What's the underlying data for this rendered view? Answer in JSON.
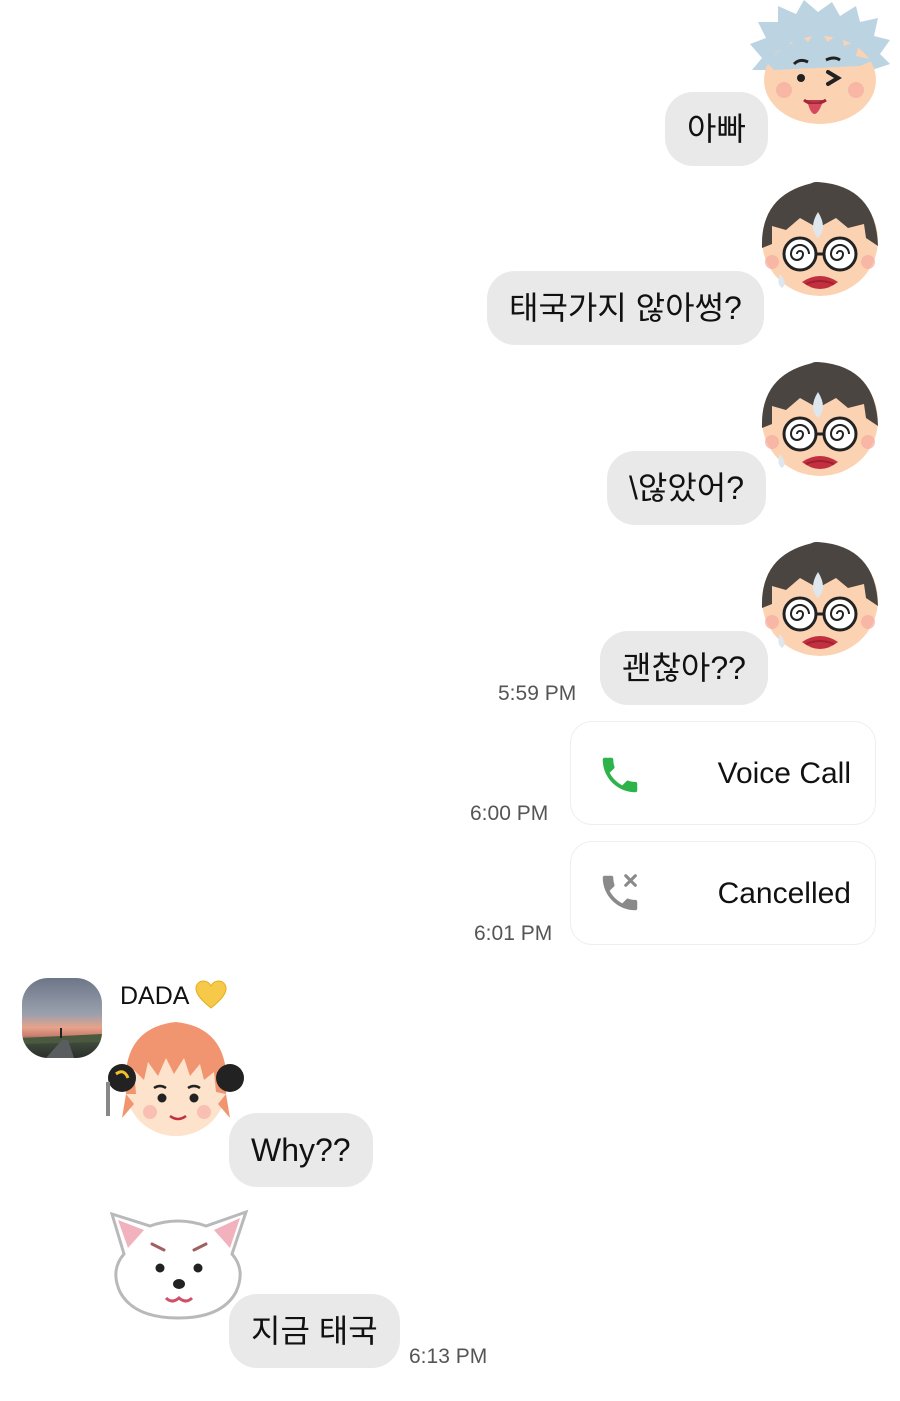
{
  "messages_sent": [
    {
      "text": "아빠",
      "sticker": "silver-hair-boy-tongue-sticker"
    },
    {
      "text": "태국가지 않아썽?",
      "sticker": "dizzy-glasses-boy-sticker"
    },
    {
      "text": "\\않았어?",
      "sticker": "dizzy-glasses-boy-sticker"
    },
    {
      "text": "괜찮아??",
      "sticker": "dizzy-glasses-boy-sticker",
      "time": "5:59 PM"
    }
  ],
  "calls": [
    {
      "label": "Voice Call",
      "icon": "phone-green-icon",
      "time": "6:00 PM"
    },
    {
      "label": "Cancelled",
      "icon": "phone-cancelled-icon",
      "time": "6:01 PM"
    }
  ],
  "received": {
    "sender": "DADA",
    "sender_badge": "yellow-heart-icon",
    "messages": [
      {
        "text": "Why??",
        "sticker": "orange-hair-girl-sticker"
      },
      {
        "text": "지금 태국",
        "sticker": "white-dog-sticker",
        "time": "6:13 PM"
      }
    ]
  },
  "colors": {
    "bubble": "#e9e9e9",
    "call_green": "#2db34a",
    "call_grey": "#8a8a8a"
  }
}
